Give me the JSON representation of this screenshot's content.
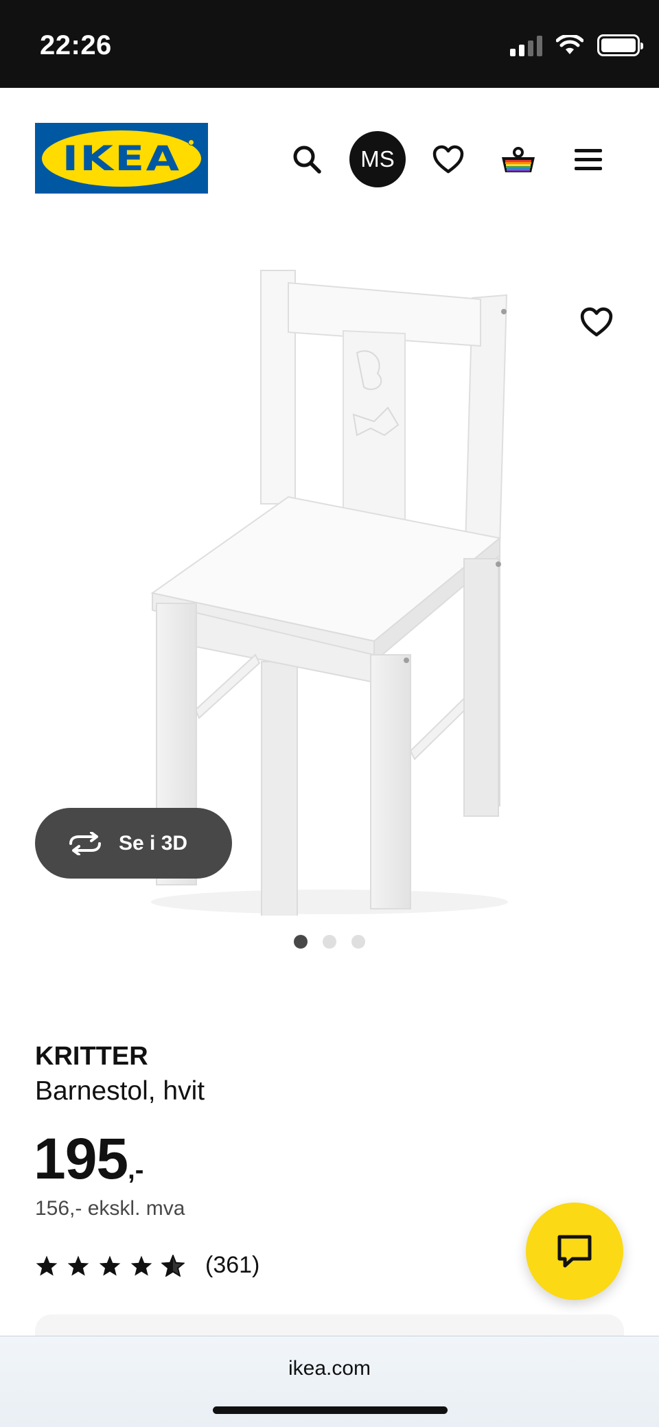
{
  "status_bar": {
    "time": "22:26"
  },
  "header": {
    "logo_text": "IKEA",
    "search_icon": "search-icon",
    "avatar_initials": "MS",
    "wishlist_icon": "heart-icon",
    "cart_icon": "basket-icon",
    "menu_icon": "hamburger-menu-icon"
  },
  "gallery": {
    "favorite_icon": "heart-icon",
    "view_3d_label": "Se i 3D",
    "image_count": 3,
    "active_image": 1
  },
  "product": {
    "name": "KRITTER",
    "description": "Barnestol, hvit",
    "price_integer": "195",
    "price_suffix": ",-",
    "price_ex_vat": "156,- ekskl. mva",
    "rating": 4.5,
    "rating_max": 5,
    "review_count": "(361)"
  },
  "chat": {
    "icon": "chat-bubble-icon"
  },
  "browser": {
    "url": "ikea.com"
  },
  "colors": {
    "ikea_blue": "#0058a3",
    "ikea_yellow": "#ffdb00",
    "chat_yellow": "#fbd914",
    "dark": "#111111",
    "button_grey": "#484848"
  }
}
